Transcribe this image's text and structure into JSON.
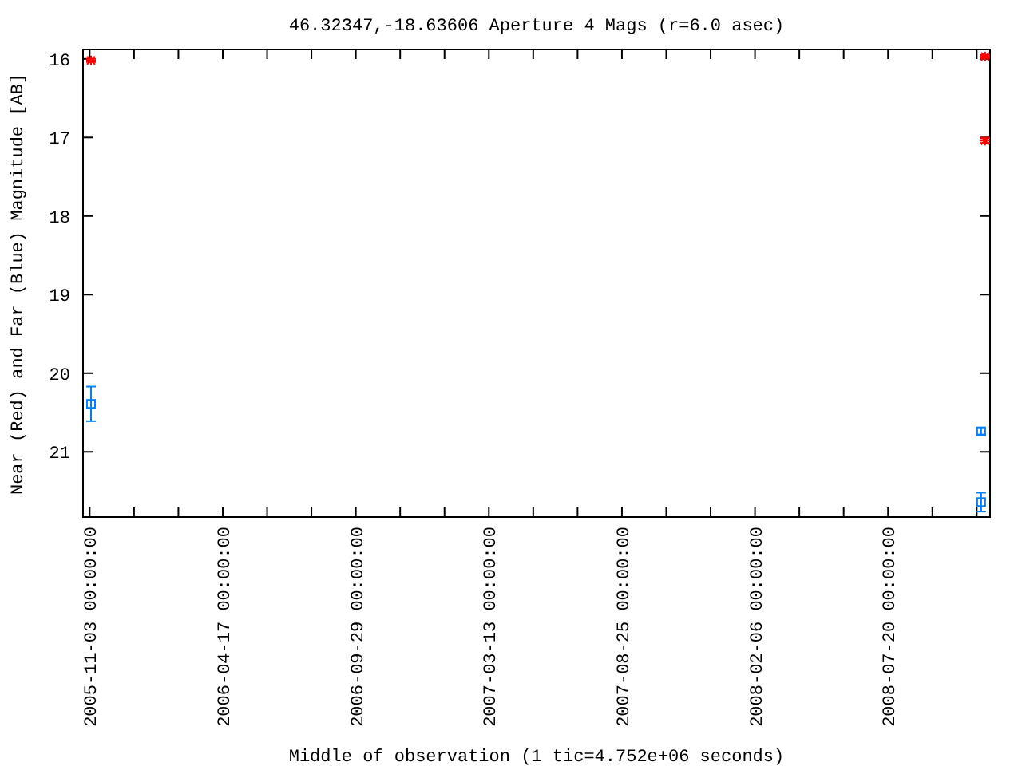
{
  "chart_data": {
    "type": "scatter",
    "title": "46.32347,-18.63606   Aperture 4 Mags (r=6.0 asec)",
    "xlabel": "Middle of observation (1 tic=4.752e+06 seconds)",
    "ylabel": "Near (Red) and Far (Blue) Magnitude [AB]",
    "x": [
      "2005-11-04T16:00:00Z",
      "2008-11-12T12:00:00Z",
      "2008-11-12T12:00:00Z",
      "2008-11-17T11:00:00Z",
      "2008-11-17T11:00:00Z"
    ],
    "xlim": [
      "2005-10-25T18:00:00Z",
      "2008-11-23T12:00:00Z"
    ],
    "ylim": [
      21.83,
      15.88
    ],
    "xticks": [
      {
        "value": "2005-11-03T00:00:00Z",
        "label": "2005-11-03 00:00:00"
      },
      {
        "value": "2006-04-17T00:00:00Z",
        "label": "2006-04-17 00:00:00"
      },
      {
        "value": "2006-09-29T00:00:00Z",
        "label": "2006-09-29 00:00:00"
      },
      {
        "value": "2007-03-13T00:00:00Z",
        "label": "2007-03-13 00:00:00"
      },
      {
        "value": "2007-08-25T00:00:00Z",
        "label": "2007-08-25 00:00:00"
      },
      {
        "value": "2008-02-06T00:00:00Z",
        "label": "2008-02-06 00:00:00"
      },
      {
        "value": "2008-07-20T00:00:00Z",
        "label": "2008-07-20 00:00:00"
      }
    ],
    "yticks": [
      16,
      17,
      18,
      19,
      20,
      21
    ],
    "series": [
      {
        "color": "#ff0000",
        "marker": "cross",
        "values": [
          16.02,
          null,
          null,
          15.97,
          17.04
        ],
        "errors": [
          0.02,
          null,
          null,
          0.02,
          0.03
        ]
      },
      {
        "color": "#0080ff",
        "marker": "square",
        "values": [
          20.39,
          20.74,
          21.64,
          null,
          null
        ],
        "errors": [
          0.22,
          0.04,
          0.12,
          null,
          null
        ]
      }
    ]
  }
}
